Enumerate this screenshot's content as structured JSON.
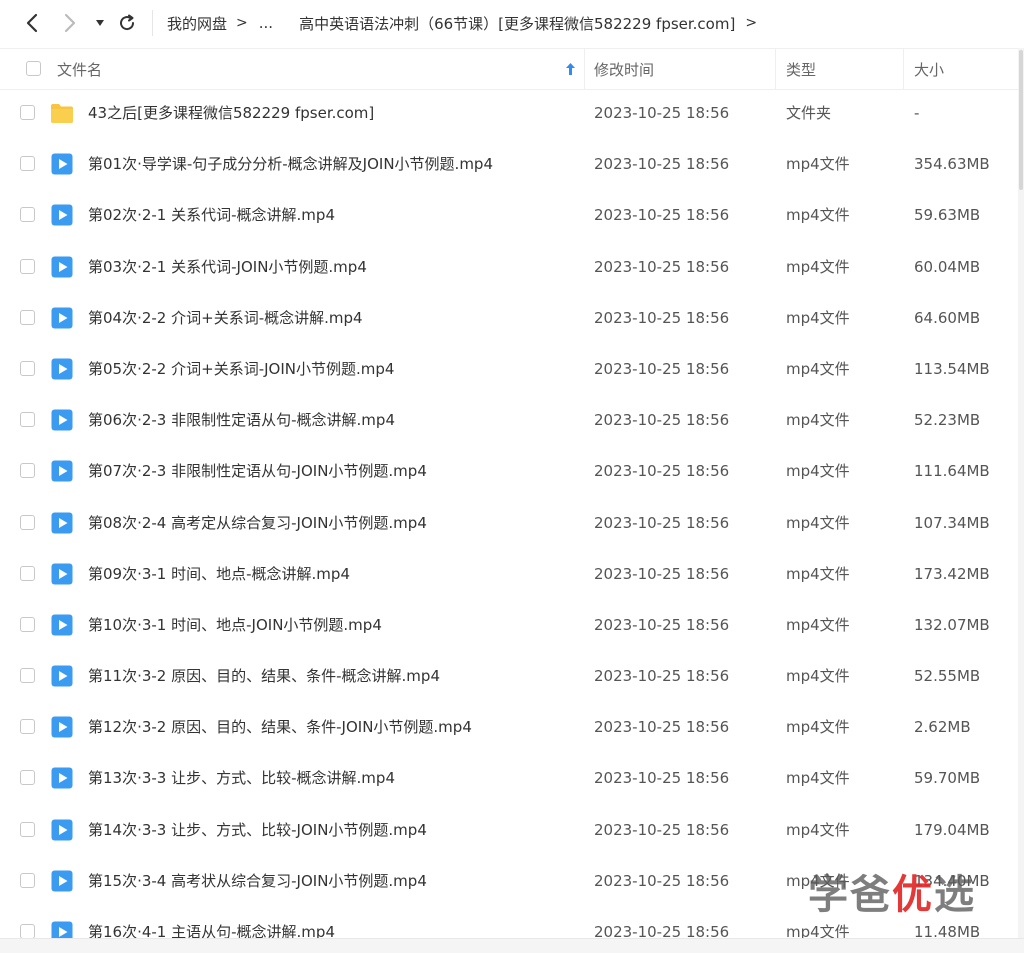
{
  "breadcrumb": {
    "root": "我的网盘",
    "ellipsis": "...",
    "current": "高中英语语法冲刺（66节课）[更多课程微信582229 fpser.com]",
    "separator": ">"
  },
  "columns": {
    "name": "文件名",
    "time": "修改时间",
    "type": "类型",
    "size": "大小"
  },
  "colors": {
    "folder": "#f7c443",
    "video": "#3a9bf0",
    "sort_arrow": "#2f8cf0"
  },
  "rows": [
    {
      "name": "43之后[更多课程微信582229 fpser.com]",
      "time": "2023-10-25 18:56",
      "type": "文件夹",
      "size": "-",
      "icon": "folder-icon"
    },
    {
      "name": "第01次·导学课-句子成分分析-概念讲解及JOIN小节例题.mp4",
      "time": "2023-10-25 18:56",
      "type": "mp4文件",
      "size": "354.63MB",
      "icon": "video-file-icon"
    },
    {
      "name": "第02次·2-1 关系代词-概念讲解.mp4",
      "time": "2023-10-25 18:56",
      "type": "mp4文件",
      "size": "59.63MB",
      "icon": "video-file-icon"
    },
    {
      "name": "第03次·2-1 关系代词-JOIN小节例题.mp4",
      "time": "2023-10-25 18:56",
      "type": "mp4文件",
      "size": "60.04MB",
      "icon": "video-file-icon"
    },
    {
      "name": "第04次·2-2 介词+关系词-概念讲解.mp4",
      "time": "2023-10-25 18:56",
      "type": "mp4文件",
      "size": "64.60MB",
      "icon": "video-file-icon"
    },
    {
      "name": "第05次·2-2 介词+关系词-JOIN小节例题.mp4",
      "time": "2023-10-25 18:56",
      "type": "mp4文件",
      "size": "113.54MB",
      "icon": "video-file-icon"
    },
    {
      "name": "第06次·2-3 非限制性定语从句-概念讲解.mp4",
      "time": "2023-10-25 18:56",
      "type": "mp4文件",
      "size": "52.23MB",
      "icon": "video-file-icon"
    },
    {
      "name": "第07次·2-3 非限制性定语从句-JOIN小节例题.mp4",
      "time": "2023-10-25 18:56",
      "type": "mp4文件",
      "size": "111.64MB",
      "icon": "video-file-icon"
    },
    {
      "name": "第08次·2-4 高考定从综合复习-JOIN小节例题.mp4",
      "time": "2023-10-25 18:56",
      "type": "mp4文件",
      "size": "107.34MB",
      "icon": "video-file-icon"
    },
    {
      "name": "第09次·3-1 时间、地点-概念讲解.mp4",
      "time": "2023-10-25 18:56",
      "type": "mp4文件",
      "size": "173.42MB",
      "icon": "video-file-icon"
    },
    {
      "name": "第10次·3-1 时间、地点-JOIN小节例题.mp4",
      "time": "2023-10-25 18:56",
      "type": "mp4文件",
      "size": "132.07MB",
      "icon": "video-file-icon"
    },
    {
      "name": "第11次·3-2 原因、目的、结果、条件-概念讲解.mp4",
      "time": "2023-10-25 18:56",
      "type": "mp4文件",
      "size": "52.55MB",
      "icon": "video-file-icon"
    },
    {
      "name": "第12次·3-2 原因、目的、结果、条件-JOIN小节例题.mp4",
      "time": "2023-10-25 18:56",
      "type": "mp4文件",
      "size": "2.62MB",
      "icon": "video-file-icon"
    },
    {
      "name": "第13次·3-3 让步、方式、比较-概念讲解.mp4",
      "time": "2023-10-25 18:56",
      "type": "mp4文件",
      "size": "59.70MB",
      "icon": "video-file-icon"
    },
    {
      "name": "第14次·3-3 让步、方式、比较-JOIN小节例题.mp4",
      "time": "2023-10-25 18:56",
      "type": "mp4文件",
      "size": "179.04MB",
      "icon": "video-file-icon"
    },
    {
      "name": "第15次·3-4 高考状从综合复习-JOIN小节例题.mp4",
      "time": "2023-10-25 18:56",
      "type": "mp4文件",
      "size": "134.40MB",
      "icon": "video-file-icon"
    },
    {
      "name": "第16次·4-1 主语从句-概念讲解.mp4",
      "time": "2023-10-25 18:56",
      "type": "mp4文件",
      "size": "11.48MB",
      "icon": "video-file-icon"
    }
  ],
  "watermark": {
    "part1": "学爸",
    "part2": "优",
    "part3": "选"
  }
}
